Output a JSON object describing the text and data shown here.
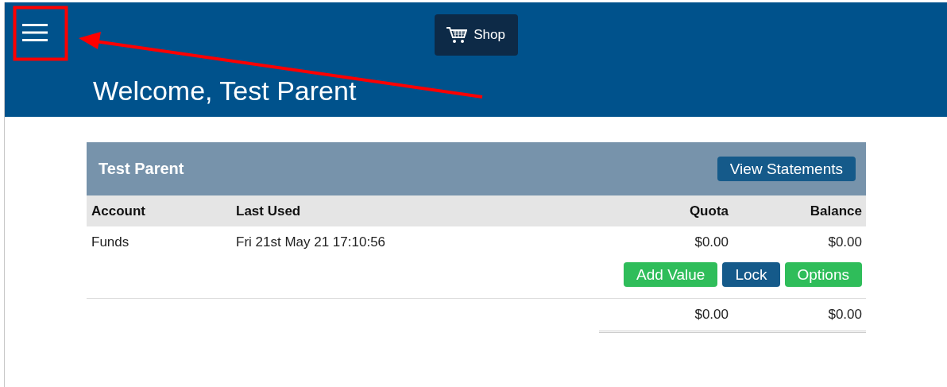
{
  "header": {
    "shop_button": "Shop",
    "welcome": "Welcome, Test Parent"
  },
  "account_card": {
    "title": "Test Parent",
    "statements_button": "View Statements",
    "columns": [
      "Account",
      "Last Used",
      "Quota",
      "Balance"
    ],
    "rows": [
      {
        "account": "Funds",
        "last_used": "Fri 21st May 21 17:10:56",
        "quota": "$0.00",
        "balance": "$0.00",
        "actions": [
          {
            "label": "Add Value",
            "kind": "success"
          },
          {
            "label": "Lock",
            "kind": "primary"
          },
          {
            "label": "Options",
            "kind": "success"
          }
        ]
      }
    ],
    "totals": {
      "quota": "$0.00",
      "balance": "$0.00"
    }
  }
}
